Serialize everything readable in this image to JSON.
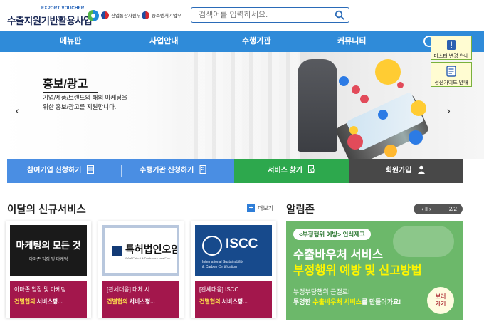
{
  "header": {
    "logo_small": "EXPORT VOUCHER",
    "logo_main": "수출지원기반활용사업",
    "gov_1": "산업통상자원부",
    "gov_2": "중소벤처기업부",
    "search_placeholder": "검색어를 입력하세요."
  },
  "nav": {
    "items": [
      "메뉴판",
      "사업안내",
      "수행기관",
      "커뮤니티"
    ]
  },
  "side_buttons": [
    "마스터 변경 안내",
    "정산가이드 안내"
  ],
  "hero": {
    "title": "홍보/광고",
    "desc_line1": "기업/제품/브랜드의 해외 마케팅을",
    "desc_line2": "위한 홍보/광고를 지원합니다.",
    "prev": "‹",
    "next": "›"
  },
  "actions": {
    "apply_company": "참여기업 신청하기",
    "apply_agency": "수행기관 신청하기",
    "find_service": "서비스 찾기",
    "signup": "회원가입"
  },
  "new_services": {
    "title": "이달의 신규서비스",
    "more": "더보기",
    "cards": [
      {
        "thumb_title": "마케팅의 모든 것",
        "thumb_sub": "아마존 입점 및 마케팅",
        "subtitle": "아마존 입점 및 마케팅",
        "org": "건별협의",
        "org_suffix": " 서비스평..."
      },
      {
        "thumb_title": "특허법인오암",
        "thumb_sub": "OAM Patent & Trademark Law Firm",
        "subtitle": "[관세대응] 대체 시...",
        "org": "건별협의",
        "org_suffix": " 서비스평..."
      },
      {
        "thumb_title": "ISCC",
        "thumb_sub_1": "International Sustainability",
        "thumb_sub_2": "& Carbon Certification",
        "subtitle": "[관세대응] ISCC",
        "org": "건별협의",
        "org_suffix": " 서비스평..."
      }
    ]
  },
  "notice": {
    "title": "알림존",
    "pager_ctrl": "‹ ll ›",
    "pager_num": "2/2",
    "tag": "<부정행위 예방> 인식제고",
    "headline_1": "수출바우처 서비스",
    "headline_2": "부정행위 예방 및 신고방법",
    "desc_1": "부정부당행위 근절로!",
    "desc_2_a": "투명한 ",
    "desc_2_b": "수출바우처 서비스",
    "desc_2_c": "를 만들어가요!",
    "view_1": "보러",
    "view_2": "가기"
  }
}
